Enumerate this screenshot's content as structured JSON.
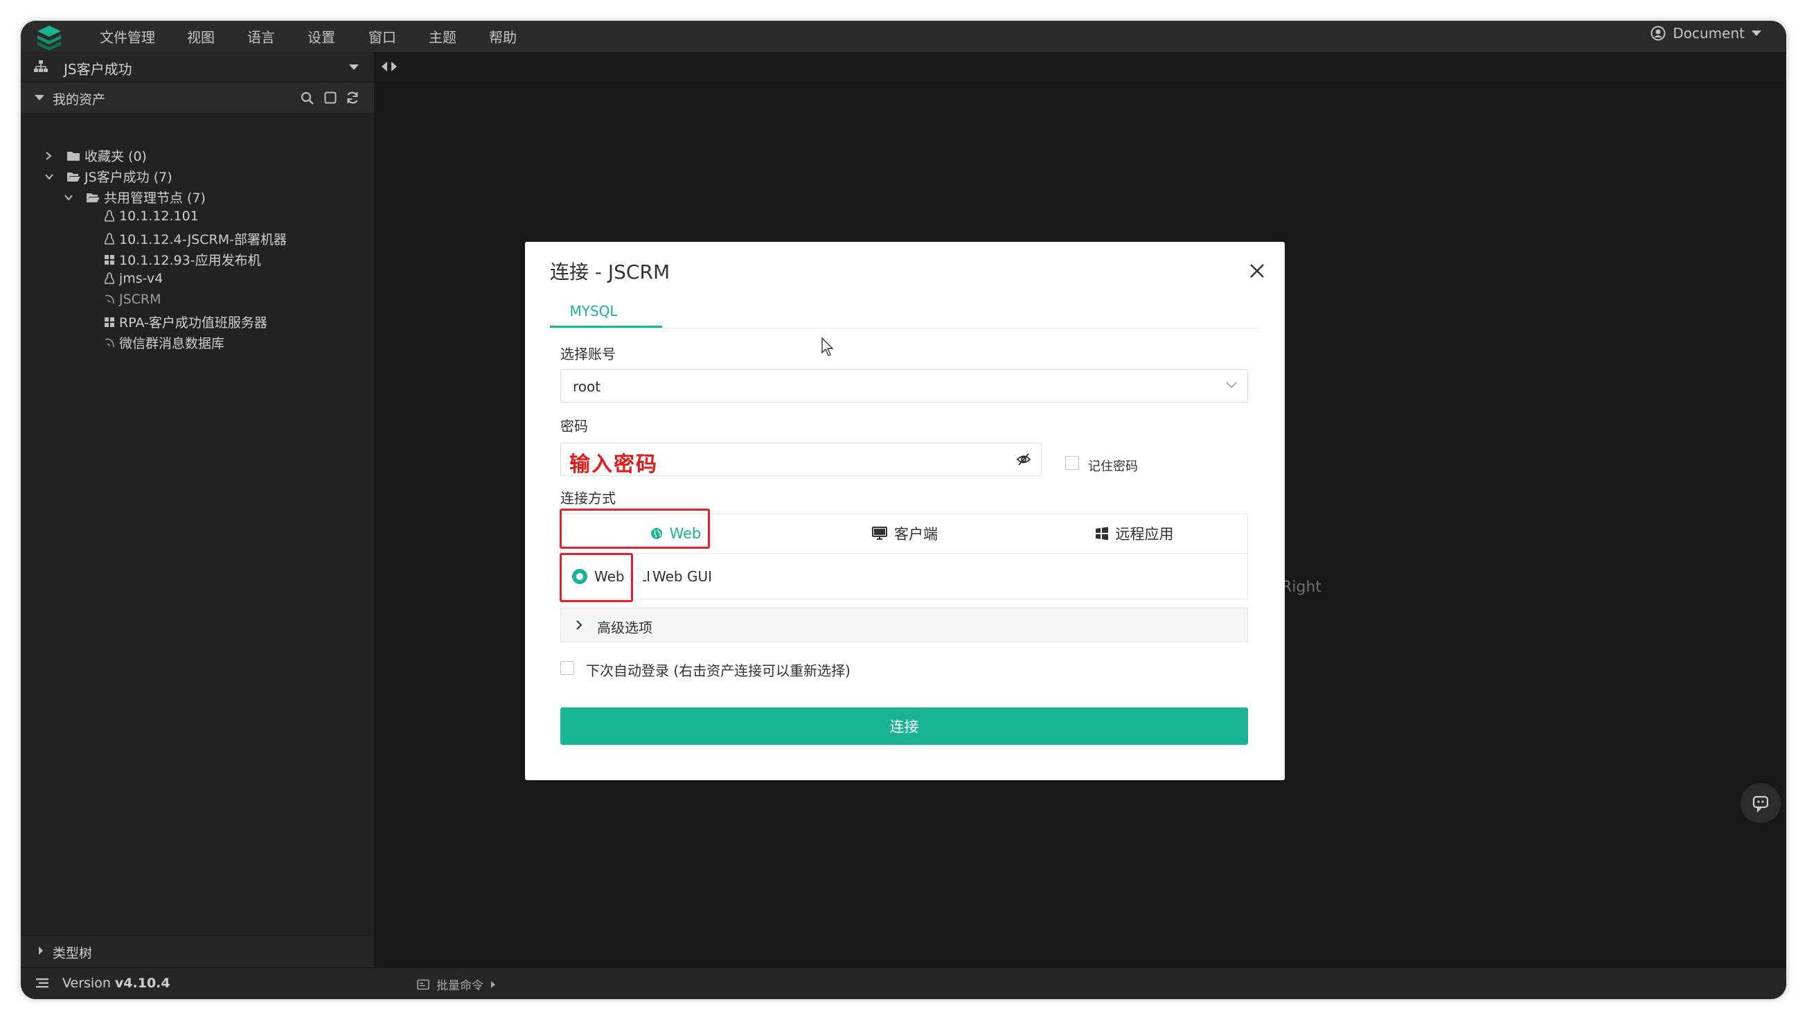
{
  "menubar": {
    "items": [
      "文件管理",
      "视图",
      "语言",
      "设置",
      "窗口",
      "主题",
      "帮助"
    ],
    "document_label": "Document"
  },
  "sidebar": {
    "org_name": "JS客户成功",
    "section_title": "我的资产",
    "tree": [
      {
        "label": "收藏夹 (0)",
        "type": "folder",
        "expanded": false,
        "depth": 0
      },
      {
        "label": "JS客户成功 (7)",
        "type": "folder-open",
        "expanded": true,
        "depth": 0
      },
      {
        "label": "共用管理节点 (7)",
        "type": "folder-open",
        "expanded": true,
        "depth": 1
      },
      {
        "label": "10.1.12.101",
        "type": "linux",
        "depth": 2
      },
      {
        "label": "10.1.12.4-JSCRM-部署机器",
        "type": "linux",
        "depth": 2
      },
      {
        "label": "10.1.12.93-应用发布机",
        "type": "windows",
        "depth": 2
      },
      {
        "label": "jms-v4",
        "type": "linux",
        "depth": 2
      },
      {
        "label": "JSCRM",
        "type": "database",
        "depth": 2
      },
      {
        "label": "RPA-客户成功值班服务器",
        "type": "windows",
        "depth": 2
      },
      {
        "label": "微信群消息数据库",
        "type": "database",
        "depth": 2
      }
    ],
    "type_tree_label": "类型树"
  },
  "status": {
    "version_prefix": "Version",
    "version": "v4.10.4",
    "batch_command": "批量命令"
  },
  "right_hint": "Right",
  "modal": {
    "title": "连接 - JSCRM",
    "tab": "MYSQL",
    "account_label": "选择账号",
    "account_value": "root",
    "password_label": "密码",
    "password_placeholder": "输入密码",
    "remember_label": "记住密码",
    "method_label": "连接方式",
    "methods": [
      "Web",
      "客户端",
      "远程应用"
    ],
    "selected_method": "Web",
    "options": [
      "Web CLI",
      "Web GUI"
    ],
    "selected_option": "Web CLI",
    "advanced_label": "高级选项",
    "auto_login_label": "下次自动登录 (右击资产连接可以重新选择)",
    "connect_button": "连接"
  },
  "colors": {
    "accent": "#1ab394",
    "highlight": "#e0202a",
    "background": "#181818",
    "sidebar": "#222222"
  }
}
